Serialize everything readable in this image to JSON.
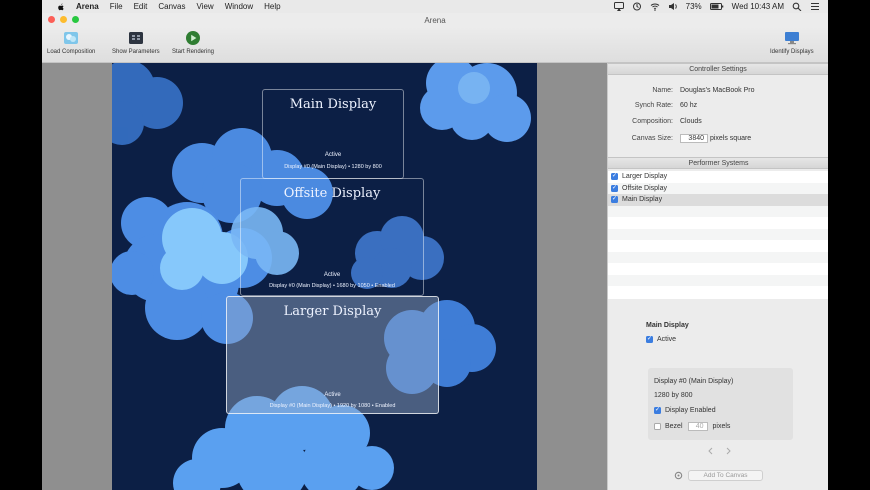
{
  "menubar": {
    "app": "Arena",
    "items": [
      "File",
      "Edit",
      "Canvas",
      "View",
      "Window",
      "Help"
    ],
    "battery": "73%",
    "clock": "Wed 10:43 AM"
  },
  "window": {
    "title": "Arena"
  },
  "toolbar": {
    "load": "Load Composition",
    "params": "Show Parameters",
    "render": "Start Rendering",
    "identify": "Identify Displays"
  },
  "canvas": {
    "displays": [
      {
        "title": "Main Display",
        "active": "Active",
        "detail": "Display #0  (Main Display)  •  1280 by 800"
      },
      {
        "title": "Offsite Display",
        "active": "Active",
        "detail": "Display #0  (Main Display)  •  1680 by 1050  •  Enabled"
      },
      {
        "title": "Larger Display",
        "active": "Active",
        "detail": "Display #0  (Main Display)  •  1920 by 1080  •  Enabled"
      }
    ]
  },
  "controller": {
    "header": "Controller Settings",
    "name_label": "Name:",
    "name": "Douglas's MacBook Pro",
    "synch_label": "Synch Rate:",
    "synch": "60 hz",
    "comp_label": "Composition:",
    "comp": "Clouds",
    "size_label": "Canvas Size:",
    "size": "3840",
    "size_unit": "pixels square"
  },
  "performers": {
    "header": "Performer Systems",
    "items": [
      "Larger Display",
      "Offsite Display",
      "Main Display"
    ]
  },
  "detail": {
    "title": "Main Display",
    "active": "Active",
    "display": "Display #0  (Main Display)",
    "resolution": "1280 by 800",
    "enabled": "Display Enabled",
    "bezel": "Bezel",
    "bezel_value": "40",
    "bezel_unit": "pixels",
    "add_button": "Add To Canvas"
  },
  "colors": {
    "canvas_bg": "#0c1f45",
    "accent": "#3b7de0"
  }
}
